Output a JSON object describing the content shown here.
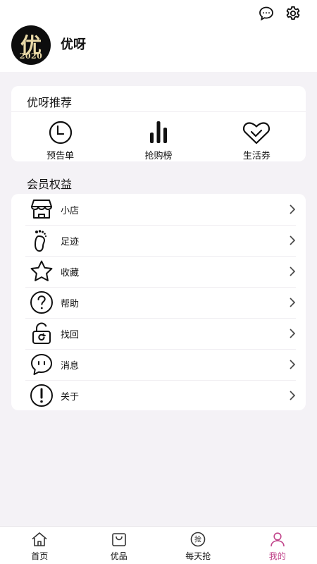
{
  "header": {
    "username": "优呀",
    "avatar": {
      "glyph": "优",
      "year": "2020",
      "colors": {
        "bg": "#0d0d0d",
        "gold": "#e9d9a6"
      }
    },
    "icons": [
      "message-icon",
      "gear-icon"
    ]
  },
  "recommend": {
    "title": "优呀推荐",
    "items": [
      {
        "label": "预告单",
        "icon": "clock-icon"
      },
      {
        "label": "抢购榜",
        "icon": "bar-chart-icon"
      },
      {
        "label": "生活券",
        "icon": "coupon-icon"
      }
    ]
  },
  "member": {
    "title": "会员权益",
    "items": [
      {
        "label": "小店",
        "icon": "store-icon"
      },
      {
        "label": "足迹",
        "icon": "footprint-icon"
      },
      {
        "label": "收藏",
        "icon": "star-icon"
      },
      {
        "label": "帮助",
        "icon": "help-icon"
      },
      {
        "label": "找回",
        "icon": "lock-refresh-icon"
      },
      {
        "label": "消息",
        "icon": "chat-icon"
      },
      {
        "label": "关于",
        "icon": "info-icon"
      }
    ]
  },
  "tabbar": {
    "active_color": "#c0438a",
    "tabs": [
      {
        "label": "首页",
        "icon": "home-icon"
      },
      {
        "label": "优品",
        "icon": "bag-icon"
      },
      {
        "label": "每天抢",
        "icon": "grab-icon",
        "glyph": "抢"
      },
      {
        "label": "我的",
        "icon": "user-icon",
        "active": true
      }
    ]
  }
}
